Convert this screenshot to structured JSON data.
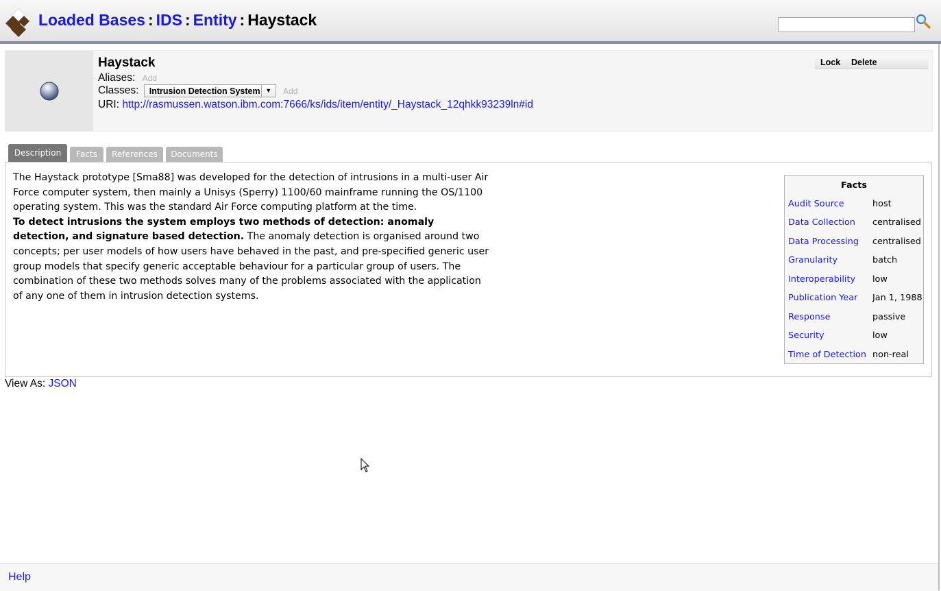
{
  "header": {
    "breadcrumbs": [
      "Loaded Bases",
      "IDS",
      "Entity"
    ],
    "current": "Haystack",
    "separator": ":",
    "search_placeholder": ""
  },
  "entity": {
    "name": "Haystack",
    "aliases_label": "Aliases:",
    "aliases_add": "Add",
    "classes_label": "Classes:",
    "class_selected": "Intrusion Detection System",
    "classes_add": "Add",
    "uri_label": "URI:",
    "uri": "http://rasmussen.watson.ibm.com:7666/ks/ids/item/entity/_Haystack_12qhkk93239ln#id",
    "actions": [
      "Lock",
      "Delete"
    ]
  },
  "tabs": [
    "Description",
    "Facts",
    "References",
    "Documents"
  ],
  "active_tab": "Description",
  "description": {
    "intro": "The Haystack prototype [Sma88] was developed for the detection of intrusions in a multi-user Air Force computer system, then mainly a Unisys (Sperry) 1100/60 mainframe running the OS/1100 operating system. This was the standard Air Force computing platform at the time.",
    "bold": "To detect intrusions the system employs two methods of detection: anomaly detection, and signature based detection.",
    "rest": " The anomaly detection is organised around two concepts; per user models of how users have behaved in the past, and pre-specified generic user group models that specify generic acceptable behaviour for a particular group of users. The combination of these two methods solves many of the problems associated with the application of any one of them in intrusion detection systems."
  },
  "facts": {
    "title": "Facts",
    "rows": [
      {
        "key": "Audit Source",
        "value": "host"
      },
      {
        "key": "Data Collection",
        "value": "centralised"
      },
      {
        "key": "Data Processing",
        "value": "centralised"
      },
      {
        "key": "Granularity",
        "value": "batch"
      },
      {
        "key": "Interoperability",
        "value": "low"
      },
      {
        "key": "Publication Year",
        "value": "Jan 1, 1988"
      },
      {
        "key": "Response",
        "value": "passive"
      },
      {
        "key": "Security",
        "value": "low"
      },
      {
        "key": "Time of Detection",
        "value": "non-real"
      }
    ]
  },
  "view_as": {
    "label": "View As:",
    "link": "JSON"
  },
  "footer": {
    "help": "Help"
  },
  "colors": {
    "link": "#1a1adf",
    "header_border": "#8a8fa8",
    "tab_active": "#777777",
    "tab_inactive": "#b8b8b8"
  }
}
